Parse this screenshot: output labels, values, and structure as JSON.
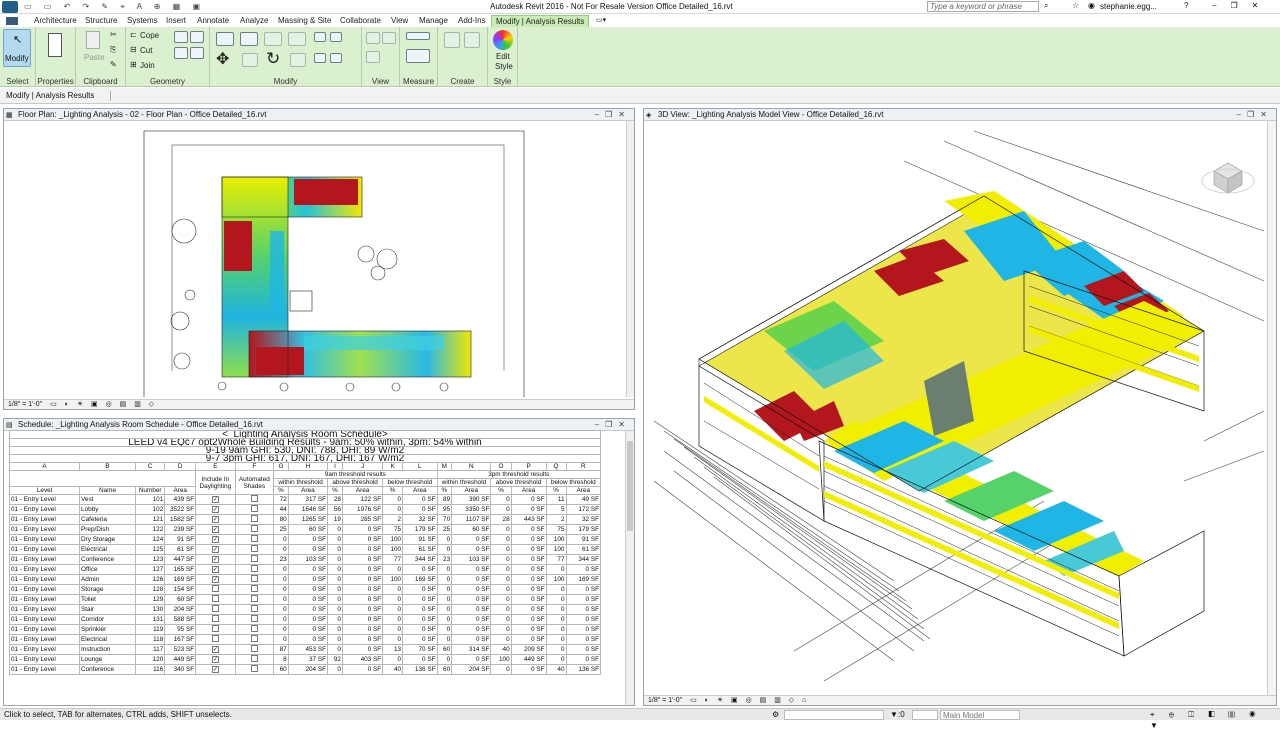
{
  "title": {
    "app": "Autodesk Revit 2016 - Not For Resale Version -",
    "file": "Office Detailed_16.rvt",
    "search_placeholder": "Type a keyword or phrase",
    "user": "stephanie.egg..."
  },
  "tabs": [
    "Architecture",
    "Structure",
    "Systems",
    "Insert",
    "Annotate",
    "Analyze",
    "Massing & Site",
    "Collaborate",
    "View",
    "Manage",
    "Add-Ins",
    "Modify | Analysis Results"
  ],
  "ribbon": {
    "modify": "Modify",
    "paste": "Paste",
    "cope": "Cope",
    "cut": "Cut",
    "join": "Join",
    "edit_style_1": "Edit",
    "edit_style_2": "Style",
    "panels": [
      "Select",
      "Properties",
      "Clipboard",
      "Geometry",
      "Modify",
      "View",
      "Measure",
      "Create",
      "Style"
    ]
  },
  "context": "Modify | Analysis Results",
  "floorplan": {
    "title": "Floor Plan: _Lighting Analysis - 02 - Floor Plan - Office Detailed_16.rvt",
    "scale": "1/8\" = 1'-0\""
  },
  "view3d": {
    "title": "3D View: _Lighting Analysis Model View - Office Detailed_16.rvt",
    "scale": "1/8\" = 1'-0\""
  },
  "schedule": {
    "window_title": "Schedule: _Lighting Analysis Room Schedule - Office Detailed_16.rvt",
    "name": "<_Lighting Analysis Room Schedule>",
    "line1": "LEED v4 EQc7 opt2Whole Building Results - 9am: 50% within, 3pm: 54% within",
    "line2": "9-19 9am GHI: 530, DNI: 788, DHI: 89 W/m2",
    "line3": "9-7 3pm GHI: 617, DNI: 167, DHI: 167 W/m2",
    "letters": [
      "A",
      "B",
      "C",
      "D",
      "E",
      "F",
      "G",
      "H",
      "I",
      "J",
      "K",
      "L",
      "M",
      "N",
      "O",
      "P",
      "Q",
      "R"
    ],
    "group_9am": "9am threshold results",
    "group_3pm": "3pm threshold results",
    "sub_within": "within threshold",
    "sub_above": "above threshold",
    "sub_below": "below threshold",
    "h_level": "Level",
    "h_name": "Name",
    "h_number": "Number",
    "h_area": "Area",
    "h_include_1": "Include In",
    "h_include_2": "Daylighting",
    "h_auto_1": "Automated",
    "h_auto_2": "Shades",
    "h_pct": "%",
    "h_area2": "Area",
    "rows": [
      [
        "01 - Entry Level",
        "Vest",
        "101",
        "439 SF",
        "✓",
        "72",
        "317 SF",
        "28",
        "122 SF",
        "0",
        "0 SF",
        "89",
        "390 SF",
        "0",
        "0 SF",
        "11",
        "49 SF"
      ],
      [
        "01 - Entry Level",
        "Lobby",
        "102",
        "3522 SF",
        "✓",
        "44",
        "1646 SF",
        "56",
        "1976 SF",
        "0",
        "0 SF",
        "95",
        "3350 SF",
        "0",
        "0 SF",
        "5",
        "172 SF"
      ],
      [
        "01 - Entry Level",
        "Cafeteria",
        "121",
        "1582 SF",
        "✓",
        "80",
        "1265 SF",
        "19",
        "285 SF",
        "2",
        "32 SF",
        "70",
        "1107 SF",
        "28",
        "443 SF",
        "2",
        "32 SF"
      ],
      [
        "01 - Entry Level",
        "Prep/Dish",
        "122",
        "239 SF",
        "✓",
        "25",
        "60 SF",
        "0",
        "0 SF",
        "75",
        "179 SF",
        "25",
        "60 SF",
        "0",
        "0 SF",
        "75",
        "179 SF"
      ],
      [
        "01 - Entry Level",
        "Dry Storage",
        "124",
        "91 SF",
        "✓",
        "0",
        "0 SF",
        "0",
        "0 SF",
        "100",
        "91 SF",
        "0",
        "0 SF",
        "0",
        "0 SF",
        "100",
        "91 SF"
      ],
      [
        "01 - Entry Level",
        "Electrical",
        "125",
        "61 SF",
        "✓",
        "0",
        "0 SF",
        "0",
        "0 SF",
        "100",
        "61 SF",
        "0",
        "0 SF",
        "0",
        "0 SF",
        "100",
        "61 SF"
      ],
      [
        "01 - Entry Level",
        "Conference",
        "123",
        "447 SF",
        "✓",
        "23",
        "103 SF",
        "0",
        "0 SF",
        "77",
        "344 SF",
        "23",
        "103 SF",
        "0",
        "0 SF",
        "77",
        "344 SF"
      ],
      [
        "01 - Entry Level",
        "Office",
        "127",
        "165 SF",
        "✓",
        "0",
        "0 SF",
        "0",
        "0 SF",
        "0",
        "0 SF",
        "0",
        "0 SF",
        "0",
        "0 SF",
        "0",
        "0 SF"
      ],
      [
        "01 - Entry Level",
        "Admin",
        "126",
        "169 SF",
        "✓",
        "0",
        "0 SF",
        "0",
        "0 SF",
        "100",
        "169 SF",
        "0",
        "0 SF",
        "0",
        "0 SF",
        "100",
        "169 SF"
      ],
      [
        "01 - Entry Level",
        "Storage",
        "128",
        "154 SF",
        "",
        "0",
        "0 SF",
        "0",
        "0 SF",
        "0",
        "0 SF",
        "0",
        "0 SF",
        "0",
        "0 SF",
        "0",
        "0 SF"
      ],
      [
        "01 - Entry Level",
        "Toilet",
        "129",
        "60 SF",
        "",
        "0",
        "0 SF",
        "0",
        "0 SF",
        "0",
        "0 SF",
        "0",
        "0 SF",
        "0",
        "0 SF",
        "0",
        "0 SF"
      ],
      [
        "01 - Entry Level",
        "Stair",
        "130",
        "204 SF",
        "",
        "0",
        "0 SF",
        "0",
        "0 SF",
        "0",
        "0 SF",
        "0",
        "0 SF",
        "0",
        "0 SF",
        "0",
        "0 SF"
      ],
      [
        "01 - Entry Level",
        "Corridor",
        "131",
        "588 SF",
        "",
        "0",
        "0 SF",
        "0",
        "0 SF",
        "0",
        "0 SF",
        "0",
        "0 SF",
        "0",
        "0 SF",
        "0",
        "0 SF"
      ],
      [
        "01 - Entry Level",
        "Sprinkler",
        "119",
        "95 SF",
        "",
        "0",
        "0 SF",
        "0",
        "0 SF",
        "0",
        "0 SF",
        "0",
        "0 SF",
        "0",
        "0 SF",
        "0",
        "0 SF"
      ],
      [
        "01 - Entry Level",
        "Electrical",
        "118",
        "167 SF",
        "",
        "0",
        "0 SF",
        "0",
        "0 SF",
        "0",
        "0 SF",
        "0",
        "0 SF",
        "0",
        "0 SF",
        "0",
        "0 SF"
      ],
      [
        "01 - Entry Level",
        "Instruction",
        "117",
        "523 SF",
        "✓",
        "87",
        "453 SF",
        "0",
        "0 SF",
        "13",
        "70 SF",
        "60",
        "314 SF",
        "40",
        "209 SF",
        "0",
        "0 SF"
      ],
      [
        "01 - Entry Level",
        "Lounge",
        "120",
        "449 SF",
        "✓",
        "8",
        "37 SF",
        "92",
        "403 SF",
        "0",
        "0 SF",
        "0",
        "0 SF",
        "100",
        "449 SF",
        "0",
        "0 SF"
      ],
      [
        "01 - Entry Level",
        "Conference",
        "116",
        "340 SF",
        "✓",
        "60",
        "204 SF",
        "0",
        "0 SF",
        "40",
        "136 SF",
        "60",
        "204 SF",
        "0",
        "0 SF",
        "40",
        "136 SF"
      ]
    ]
  },
  "status": {
    "hint": "Click to select, TAB for alternates, CTRL adds, SHIFT unselects.",
    "zero": ":0",
    "model": "Main Model"
  }
}
